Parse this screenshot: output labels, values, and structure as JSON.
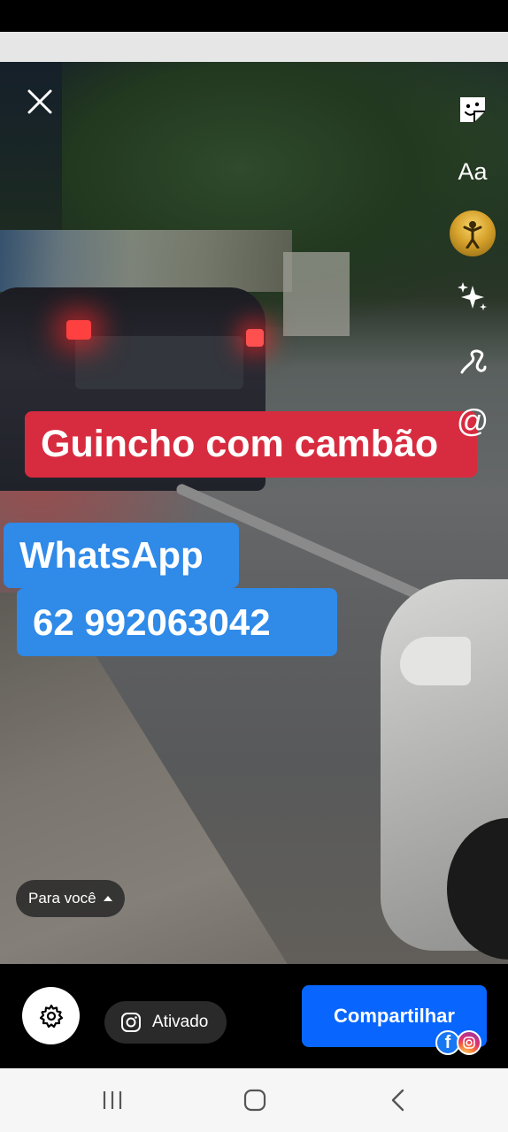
{
  "story": {
    "captions": {
      "title": "Guincho com cambão",
      "contact_label": "WhatsApp",
      "phone": "62 992063042"
    },
    "caption_colors": {
      "title_bg": "#d72c3f",
      "contact_bg": "#2f8ae8"
    }
  },
  "side_tools": {
    "text_tool_label": "Aa",
    "mention_label": "@",
    "icons": [
      "close-icon",
      "sticker-icon",
      "text-icon",
      "avatar",
      "sparkle-icon",
      "squiggle-icon",
      "mention-icon"
    ]
  },
  "audience": {
    "label": "Para você"
  },
  "bottom": {
    "instagram_toggle_label": "Ativado",
    "share_label": "Compartilhar",
    "share_color": "#0866ff",
    "fb_badge_letter": "f"
  },
  "nav": {
    "icons": [
      "recent-apps-icon",
      "home-icon",
      "back-icon"
    ]
  }
}
